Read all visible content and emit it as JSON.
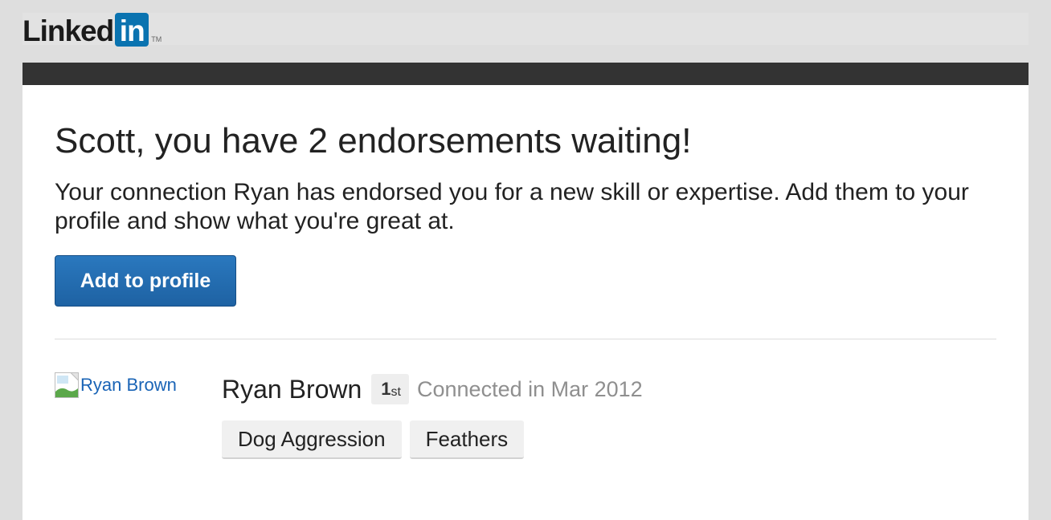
{
  "brand": {
    "logo_text": "Linked",
    "logo_badge": "in",
    "trademark": "TM",
    "colors": {
      "badge": "#0a73b0",
      "header_bar": "#333333",
      "button": "#1e62a3",
      "link": "#1a64b6"
    }
  },
  "email": {
    "headline": "Scott, you have 2 endorsements waiting!",
    "body": "Your connection Ryan has endorsed you for a new skill or expertise. Add them to your profile and show what you're great at.",
    "cta_label": "Add to profile"
  },
  "endorser": {
    "avatar_alt": "Ryan Brown",
    "avatar_icon": "broken-image-icon",
    "name": "Ryan Brown",
    "degree_num": "1",
    "degree_suffix": "st",
    "connected": "Connected in Mar 2012"
  },
  "skills": [
    {
      "label": "Dog Aggression"
    },
    {
      "label": "Feathers"
    }
  ]
}
